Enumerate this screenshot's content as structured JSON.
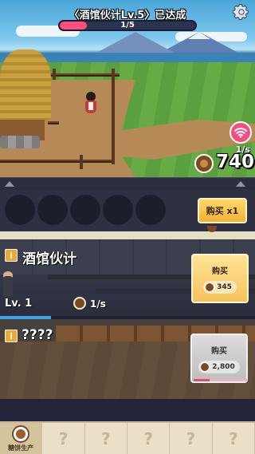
{
  "quest": {
    "title": "〈酒馆伙计Lv.5〉已达成",
    "progress_text": "1/5",
    "progress_fraction": 0.2
  },
  "hud": {
    "settings_icon": "gear-icon",
    "ad_icon": "wifi-icon",
    "income_rate": "1/s",
    "coins": "740",
    "accent_color": "#ff4f7a"
  },
  "purchase": {
    "button_label": "购买 x1"
  },
  "businesses": [
    {
      "name": "酒馆伙计",
      "level": "Lv. 1",
      "rate": "1/s",
      "buy_label": "购买",
      "price": "345",
      "progress_fraction": 0.2
    },
    {
      "name": "????",
      "buy_label": "购买",
      "price": "2,800",
      "progress_fraction": 0.3
    }
  ],
  "tabs": [
    {
      "label": "糖饼生产",
      "icon": "cookie-icon",
      "active": true
    },
    {
      "label": "?",
      "locked": true
    },
    {
      "label": "?",
      "locked": true
    },
    {
      "label": "?",
      "locked": true
    },
    {
      "label": "?",
      "locked": true
    },
    {
      "label": "?",
      "locked": true
    }
  ]
}
